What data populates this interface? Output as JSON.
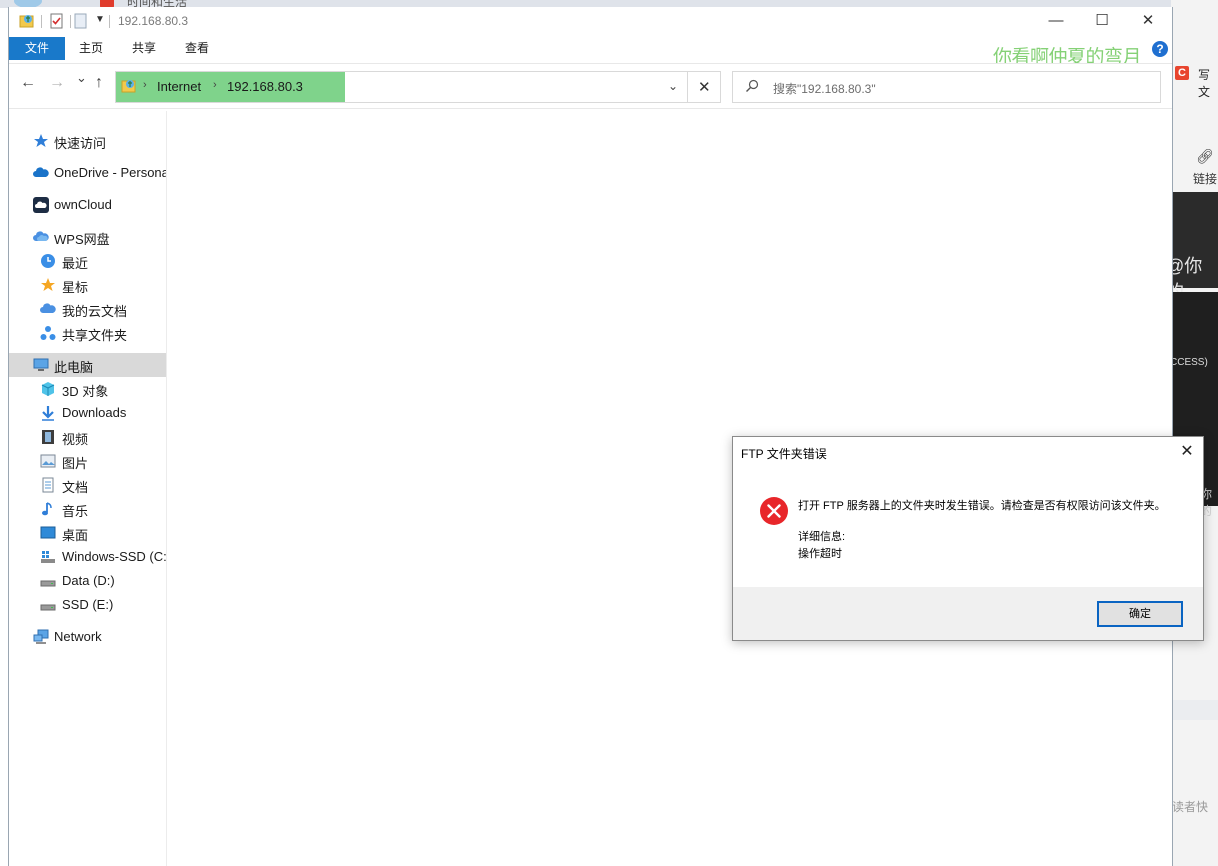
{
  "background": {
    "tab_title": "时间和生活",
    "csdn_label": "C",
    "write_label": "写文",
    "link_label": "链接",
    "at_text": "@你的",
    "success_text": "CCESS)",
    "ni_text": "你的",
    "reader_text": "读者快"
  },
  "window": {
    "title": "192.168.80.3",
    "controls": {
      "minimize": "—",
      "maximize": "☐",
      "close": "✕"
    }
  },
  "ribbon": {
    "tabs": [
      "文件",
      "主页",
      "共享",
      "查看"
    ],
    "watermark": "你看啊仲夏的弯月",
    "help": "?"
  },
  "nav": {
    "back": "←",
    "forward": "→",
    "recent": "⌄",
    "up": "↑"
  },
  "address": {
    "crumbs": [
      "Internet",
      "192.168.80.3"
    ],
    "chevron": "⌄",
    "clear": "✕"
  },
  "search": {
    "placeholder": "搜索\"192.168.80.3\""
  },
  "sidebar": {
    "items": [
      {
        "label": "快速访问",
        "icon": "star-icon"
      },
      {
        "label": "OneDrive - Persona",
        "icon": "onedrive-icon"
      },
      {
        "label": "ownCloud",
        "icon": "owncloud-icon"
      },
      {
        "label": "WPS网盘",
        "icon": "wps-cloud-icon"
      },
      {
        "label": "最近",
        "icon": "clock-icon"
      },
      {
        "label": "星标",
        "icon": "star-filled-icon"
      },
      {
        "label": "我的云文档",
        "icon": "cloud-docs-icon"
      },
      {
        "label": "共享文件夹",
        "icon": "shared-folder-icon"
      },
      {
        "label": "此电脑",
        "icon": "this-pc-icon"
      },
      {
        "label": "3D 对象",
        "icon": "cube-icon"
      },
      {
        "label": "Downloads",
        "icon": "download-icon"
      },
      {
        "label": "视频",
        "icon": "video-icon"
      },
      {
        "label": "图片",
        "icon": "picture-icon"
      },
      {
        "label": "文档",
        "icon": "document-icon"
      },
      {
        "label": "音乐",
        "icon": "music-icon"
      },
      {
        "label": "桌面",
        "icon": "desktop-icon"
      },
      {
        "label": "Windows-SSD (C:)",
        "icon": "windows-drive-icon"
      },
      {
        "label": "Data (D:)",
        "icon": "drive-icon"
      },
      {
        "label": "SSD (E:)",
        "icon": "drive-icon"
      },
      {
        "label": "Network",
        "icon": "network-icon"
      }
    ]
  },
  "dialog": {
    "title": "FTP 文件夹错误",
    "close": "✕",
    "message": "打开 FTP 服务器上的文件夹时发生错误。请检查是否有权限访问该文件夹。",
    "detail_label": "详细信息:",
    "detail": "操作超时",
    "ok": "确定"
  },
  "colors": {
    "ribbon_file_tab": "#1979ca",
    "address_highlight": "#7fd38b",
    "error_red": "#e8262a",
    "dialog_button_border": "#0a64c2",
    "sidebar_selected": "#d9d9d9"
  }
}
